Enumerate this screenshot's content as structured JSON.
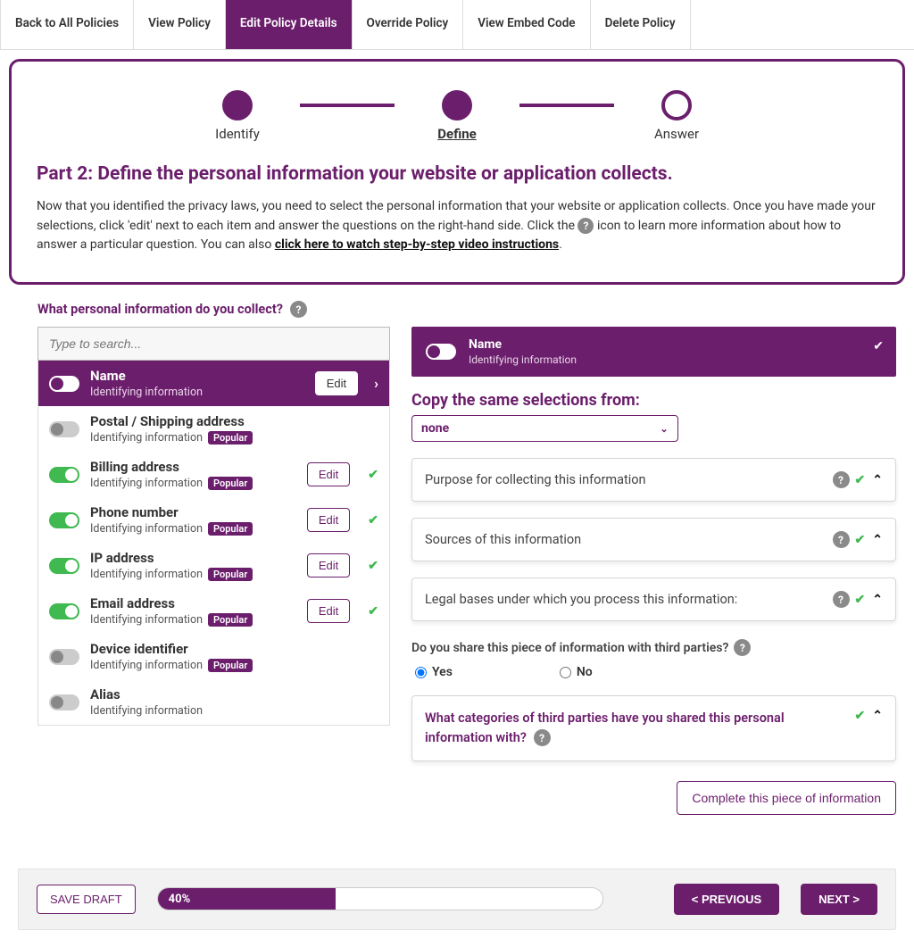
{
  "tabs": {
    "items": [
      {
        "label": "Back to All Policies"
      },
      {
        "label": "View Policy"
      },
      {
        "label": "Edit Policy Details"
      },
      {
        "label": "Override Policy"
      },
      {
        "label": "View Embed Code"
      },
      {
        "label": "Delete Policy"
      }
    ],
    "active_index": 2
  },
  "stepper": {
    "steps": [
      "Identify",
      "Define",
      "Answer"
    ],
    "active_index": 1
  },
  "panel": {
    "heading": "Part 2: Define the personal information your website or application collects.",
    "body_a": "Now that you identified the privacy laws, you need to select the personal information that your website or application collects. Once you have made your selections, click 'edit' next to each item and answer the questions on the right-hand side. Click the ",
    "body_b": " icon to learn more information about how to answer a particular question. You can also ",
    "body_link": "click here to watch step-by-step video instructions",
    "body_c": "."
  },
  "left": {
    "title": "What personal information do you collect?",
    "search_placeholder": "Type to search...",
    "edit_label": "Edit",
    "category_label": "Identifying information",
    "popular_label": "Popular",
    "items": [
      {
        "name": "Name",
        "on": true,
        "selected": true,
        "popular": false,
        "editable": true,
        "check": false
      },
      {
        "name": "Postal / Shipping address",
        "on": false,
        "selected": false,
        "popular": true,
        "editable": false,
        "check": false
      },
      {
        "name": "Billing address",
        "on": true,
        "selected": false,
        "popular": true,
        "editable": true,
        "check": true
      },
      {
        "name": "Phone number",
        "on": true,
        "selected": false,
        "popular": true,
        "editable": true,
        "check": true
      },
      {
        "name": "IP address",
        "on": true,
        "selected": false,
        "popular": true,
        "editable": true,
        "check": true
      },
      {
        "name": "Email address",
        "on": true,
        "selected": false,
        "popular": true,
        "editable": true,
        "check": true
      },
      {
        "name": "Device identifier",
        "on": false,
        "selected": false,
        "popular": true,
        "editable": false,
        "check": false
      },
      {
        "name": "Alias",
        "on": false,
        "selected": false,
        "popular": false,
        "editable": false,
        "check": false
      }
    ]
  },
  "right": {
    "header_name": "Name",
    "header_sub": "Identifying information",
    "copy_title": "Copy the same selections from:",
    "copy_value": "none",
    "accordions": [
      {
        "title": "Purpose for collecting this information"
      },
      {
        "title": "Sources of this information"
      },
      {
        "title": "Legal bases under which you process this information:"
      }
    ],
    "share_question": "Do you share this piece of information with third parties?",
    "share_yes": "Yes",
    "share_no": "No",
    "share_value": "yes",
    "third_party_title": "What categories of third parties have you shared this personal information with?",
    "complete_label": "Complete this piece of information"
  },
  "footer": {
    "save_label": "SAVE DRAFT",
    "progress_percent": 40,
    "progress_label": "40%",
    "prev_label": "< PREVIOUS",
    "next_label": "NEXT >"
  }
}
